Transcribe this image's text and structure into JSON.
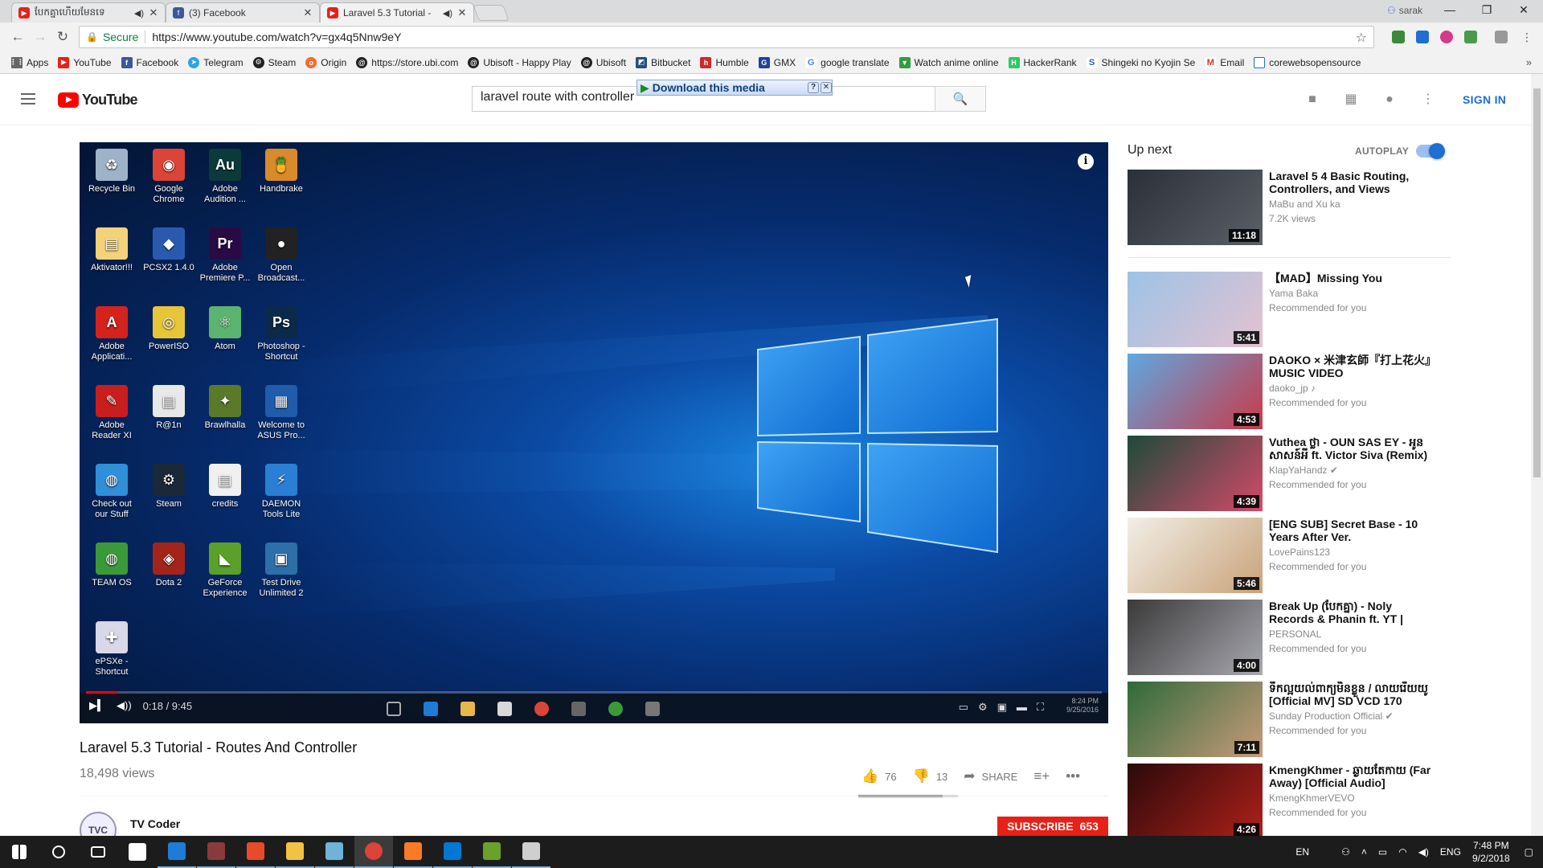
{
  "browser": {
    "tabs": [
      {
        "title": "បែកគ្នាហើយមែនទេ",
        "favicon_color": "#e62117",
        "has_sound": true
      },
      {
        "title": "(3) Facebook",
        "favicon_color": "#3b5998",
        "has_sound": false
      },
      {
        "title": "Laravel 5.3 Tutorial - ",
        "favicon_color": "#e62117",
        "has_sound": true
      }
    ],
    "profile_name": "sarak",
    "omnibox": {
      "secure_label": "Secure",
      "url": "https://www.youtube.com/watch?v=gx4q5Nnw9eY"
    },
    "bookmarks": [
      {
        "label": "Apps",
        "color": "#666"
      },
      {
        "label": "YouTube",
        "color": "#e62117"
      },
      {
        "label": "Facebook",
        "color": "#3b5998"
      },
      {
        "label": "Telegram",
        "color": "#2ca5e0"
      },
      {
        "label": "Steam",
        "color": "#222"
      },
      {
        "label": "Origin",
        "color": "#f56c2d"
      },
      {
        "label": "https://store.ubi.com",
        "color": "#222"
      },
      {
        "label": "Ubisoft - Happy Play",
        "color": "#222"
      },
      {
        "label": "Ubisoft",
        "color": "#222"
      },
      {
        "label": "Bitbucket",
        "color": "#205081"
      },
      {
        "label": "Humble",
        "color": "#cc2929"
      },
      {
        "label": "GMX",
        "color": "#1c449b"
      },
      {
        "label": "google translate",
        "color": "#4285f4"
      },
      {
        "label": "Watch anime online",
        "color": "#2e9e3e"
      },
      {
        "label": "HackerRank",
        "color": "#2ec866"
      },
      {
        "label": "Shingeki no Kyojin Se",
        "color": "#1f5fbf"
      },
      {
        "label": "Email",
        "color": "#d93025"
      },
      {
        "label": "corewebsopensource",
        "color": "#1f6ed1"
      }
    ]
  },
  "youtube": {
    "logo_text": "YouTube",
    "search_value": "laravel route with controller",
    "download_bar": "Download this media",
    "signin": "SIGN IN"
  },
  "player": {
    "time": "0:18 / 9:45",
    "progress": 0.032,
    "desktop_icons": [
      {
        "label": "Recycle Bin",
        "color": "#9fb3c8",
        "glyph": "♻"
      },
      {
        "label": "Google Chrome",
        "color": "#db4437",
        "glyph": "◉"
      },
      {
        "label": "Adobe Audition ...",
        "color": "#0b3a3a",
        "glyph": "Au"
      },
      {
        "label": "Handbrake",
        "color": "#d98a2a",
        "glyph": "🍍"
      },
      {
        "label": "Aktivator!!!",
        "color": "#f3d27a",
        "glyph": "▤"
      },
      {
        "label": "PCSX2 1.4.0",
        "color": "#2a5ab0",
        "glyph": "◆"
      },
      {
        "label": "Adobe Premiere P...",
        "color": "#2a0a45",
        "glyph": "Pr"
      },
      {
        "label": "Open Broadcast...",
        "color": "#222",
        "glyph": "●"
      },
      {
        "label": "Adobe Applicati...",
        "color": "#d4231d",
        "glyph": "A"
      },
      {
        "label": "PowerISO",
        "color": "#e6c638",
        "glyph": "◎"
      },
      {
        "label": "Atom",
        "color": "#5bb46f",
        "glyph": "⚛"
      },
      {
        "label": "Photoshop - Shortcut",
        "color": "#0b2a4a",
        "glyph": "Ps"
      },
      {
        "label": "Adobe Reader XI",
        "color": "#c81e1e",
        "glyph": "✎"
      },
      {
        "label": "R@1n",
        "color": "#e8e8e8",
        "glyph": "▤"
      },
      {
        "label": "Brawlhalla",
        "color": "#5a7a2a",
        "glyph": "✦"
      },
      {
        "label": "Welcome to ASUS Pro...",
        "color": "#1f5cab",
        "glyph": "▦"
      },
      {
        "label": "Check out our Stuff",
        "color": "#2f8fd8",
        "glyph": "◍"
      },
      {
        "label": "Steam",
        "color": "#1b2838",
        "glyph": "⚙"
      },
      {
        "label": "credits",
        "color": "#f0f0f0",
        "glyph": "▤"
      },
      {
        "label": "DAEMON Tools Lite",
        "color": "#2a7fd4",
        "glyph": "⚡"
      },
      {
        "label": "TEAM OS",
        "color": "#3a9a3a",
        "glyph": "◍"
      },
      {
        "label": "Dota 2",
        "color": "#a3251a",
        "glyph": "◈"
      },
      {
        "label": "GeForce Experience",
        "color": "#5aa02a",
        "glyph": "◣"
      },
      {
        "label": "Test Drive Unlimited 2",
        "color": "#2d6fa8",
        "glyph": "▣"
      },
      {
        "label": "ePSXe - Shortcut",
        "color": "#d8d8e8",
        "glyph": "✚"
      }
    ],
    "video_clock": {
      "time": "8:24 PM",
      "date": "9/25/2016"
    }
  },
  "video": {
    "title": "Laravel 5.3 Tutorial - Routes And Controller",
    "views": "18,498 views",
    "likes": "76",
    "dislikes": "13",
    "share_label": "SHARE",
    "like_ratio": 0.85,
    "channel_name": "TV Coder",
    "channel_avatar_text": "TVC",
    "subscribe_label": "SUBSCRIBE",
    "subscriber_count": "653"
  },
  "sidebar": {
    "up_next_label": "Up next",
    "autoplay_label": "AUTOPLAY",
    "items": [
      {
        "title": "Laravel 5 4 Basic Routing, Controllers, and Views",
        "channel": "MaBu and Xu ka",
        "meta": "7.2K views",
        "duration": "11:18",
        "thumb_a": "#2a2f38",
        "thumb_b": "#5a6068"
      },
      {
        "title": "【MAD】Missing You",
        "channel": "Yama Baka",
        "meta": "Recommended for you",
        "duration": "5:41",
        "thumb_a": "#9cc3e6",
        "thumb_b": "#e4c2d0"
      },
      {
        "title": "DAOKO × 米津玄師『打上花火』MUSIC VIDEO",
        "channel": "daoko_jp ♪",
        "meta": "Recommended for you",
        "duration": "4:53",
        "thumb_a": "#5ea8e0",
        "thumb_b": "#c93a4a"
      },
      {
        "title": "Vuthea ថ្លា - OUN SAS EY - អូនសាសន៍អី ft. Victor Siva (Remix)",
        "channel": "KlapYaHandz ✔",
        "meta": "Recommended for you",
        "duration": "4:39",
        "thumb_a": "#1d4a3a",
        "thumb_b": "#d44a6a"
      },
      {
        "title": "[ENG SUB] Secret Base - 10 Years After Ver.",
        "channel": "LovePains123",
        "meta": "Recommended for you",
        "duration": "5:46",
        "thumb_a": "#f1efe6",
        "thumb_b": "#c9a27a"
      },
      {
        "title": "Break Up (បែកគ្នា) - Noly Records & Phanin ft. YT | Prod...",
        "channel": "PERSONAL",
        "meta": "Recommended for you",
        "duration": "4:00",
        "thumb_a": "#3a3a3a",
        "thumb_b": "#a8a8b0"
      },
      {
        "title": "ទឹកល្អយល់ពាក្យមិនខ្លួន / លាយរើយយូ [Official MV] SD VCD 170",
        "channel": "Sunday Production Official ✔",
        "meta": "Recommended for you",
        "duration": "7:11",
        "thumb_a": "#2e6a3a",
        "thumb_b": "#c89a7a"
      },
      {
        "title": "KmengKhmer - ឆ្ងាយតែកាយ (Far Away) [Official Audio]",
        "channel": "KmengKhmerVEVO",
        "meta": "Recommended for you",
        "duration": "4:26",
        "thumb_a": "#2a0a0a",
        "thumb_b": "#b0201a"
      }
    ]
  },
  "taskbar": {
    "apps": [
      {
        "name": "start",
        "color": "#ffffff"
      },
      {
        "name": "search",
        "color": "#ffffff"
      },
      {
        "name": "task-view",
        "color": "#ffffff"
      },
      {
        "name": "store",
        "color": "#ffffff"
      },
      {
        "name": "edge",
        "color": "#1e7bd8"
      },
      {
        "name": "winrar",
        "color": "#8a3a3a"
      },
      {
        "name": "app-red",
        "color": "#e84a2a"
      },
      {
        "name": "explorer",
        "color": "#f3c244"
      },
      {
        "name": "notepad",
        "color": "#6fb3d8"
      },
      {
        "name": "chrome",
        "color": "#db4437"
      },
      {
        "name": "xampp",
        "color": "#fb7a24"
      },
      {
        "name": "vscode",
        "color": "#0078d4"
      },
      {
        "name": "hearthstone",
        "color": "#6ba02a"
      },
      {
        "name": "dev-tool",
        "color": "#cfcfcf"
      }
    ],
    "lang_short": "EN",
    "lang_long": "ENG",
    "time": "7:48 PM",
    "date": "9/2/2018"
  }
}
